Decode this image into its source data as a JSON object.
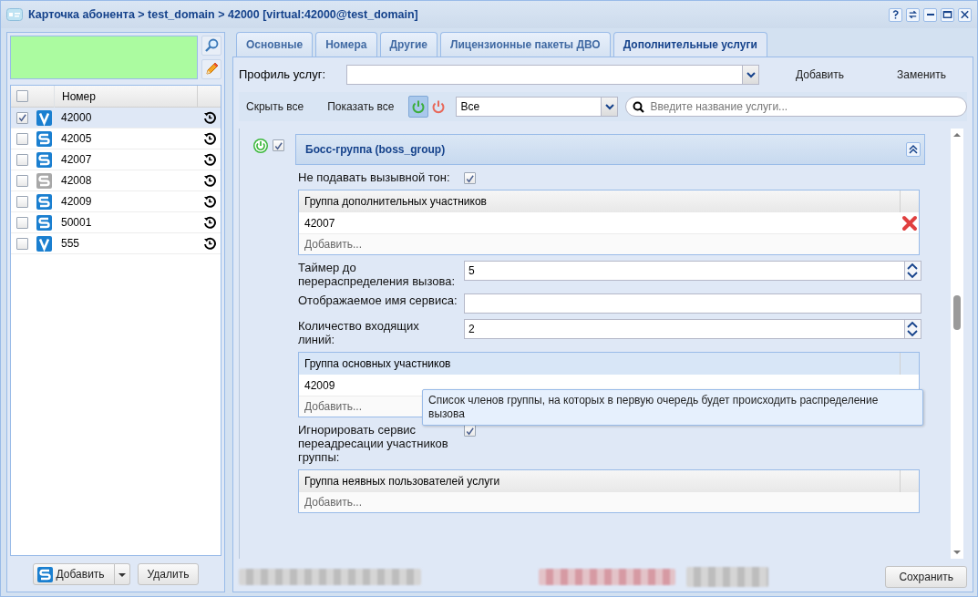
{
  "window": {
    "title": "Карточка абонента > test_domain > 42000 [virtual:42000@test_domain]"
  },
  "sidebar": {
    "column": "Номер",
    "all_checked": false,
    "rows": [
      {
        "number": "42000",
        "kind": "virtual",
        "disabled": false,
        "checked": true,
        "selected": true
      },
      {
        "number": "42005",
        "kind": "sip",
        "disabled": false,
        "checked": false,
        "selected": false
      },
      {
        "number": "42007",
        "kind": "sip",
        "disabled": false,
        "checked": false,
        "selected": false
      },
      {
        "number": "42008",
        "kind": "sip",
        "disabled": true,
        "checked": false,
        "selected": false
      },
      {
        "number": "42009",
        "kind": "sip",
        "disabled": false,
        "checked": false,
        "selected": false
      },
      {
        "number": "50001",
        "kind": "sip",
        "disabled": false,
        "checked": false,
        "selected": false
      },
      {
        "number": "555",
        "kind": "virtual",
        "disabled": false,
        "checked": false,
        "selected": false
      }
    ],
    "add_button": "Добавить",
    "delete_button": "Удалить"
  },
  "tabs": [
    {
      "label": "Основные",
      "selected": false
    },
    {
      "label": "Номера",
      "selected": false
    },
    {
      "label": "Другие",
      "selected": false
    },
    {
      "label": "Лицензионные пакеты ДВО",
      "selected": false
    },
    {
      "label": "Дополнительные услуги",
      "selected": true
    }
  ],
  "profile": {
    "label": "Профиль услуг:",
    "add": "Добавить",
    "replace": "Заменить"
  },
  "toolbar": {
    "hide_all": "Скрыть все",
    "show_all": "Показать все",
    "enabled_filter_on": true,
    "filter": "Все",
    "search_placeholder": "Введите название услуги..."
  },
  "service": {
    "title": "Босс-группа (boss_group)",
    "enabled": true,
    "checked": true,
    "expanded": true,
    "fields": [
      {
        "kind": "checkbox",
        "label": "Не подавать вызывной тон:",
        "checked": true
      },
      {
        "kind": "grid",
        "header": "Группа дополнительных участников",
        "rows": [
          "42007"
        ],
        "add": "Добавить...",
        "highlighted": false
      },
      {
        "kind": "spinner",
        "label": "Таймер до перераспределения вызова:",
        "value": "5"
      },
      {
        "kind": "text",
        "label": "Отображаемое имя сервиса:"
      },
      {
        "kind": "spinner",
        "label": "Количество входящих линий:",
        "value": "2"
      },
      {
        "kind": "grid",
        "header": "Группа основных участников",
        "rows": [
          "42009"
        ],
        "add": "Добавить...",
        "highlighted": true
      },
      {
        "kind": "checkbox",
        "label": "Игнорировать сервис переадресации участников группы:",
        "checked": true
      },
      {
        "kind": "grid",
        "header": "Группа неявных пользователей услуги",
        "add": "Добавить...",
        "highlighted": false
      }
    ]
  },
  "tooltip": "Список членов группы, на которых в первую очередь будет происходить распределение вызова",
  "save_button": "Сохранить"
}
